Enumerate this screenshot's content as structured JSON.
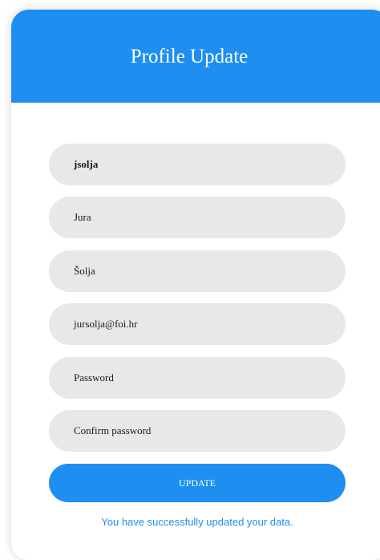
{
  "header": {
    "title": "Profile Update"
  },
  "form": {
    "username_value": "jsolja",
    "first_name_value": "Jura",
    "last_name_value": "Šolja",
    "email_value": "jursolja@foi.hr",
    "password_placeholder": "Password",
    "confirm_password_placeholder": "Confirm password",
    "submit_label": "UPDATE"
  },
  "status": {
    "message": "You have successfully updated your data."
  },
  "colors": {
    "accent": "#1e8ef0",
    "field_background": "#e8e8e8",
    "card_background": "#ffffff"
  }
}
